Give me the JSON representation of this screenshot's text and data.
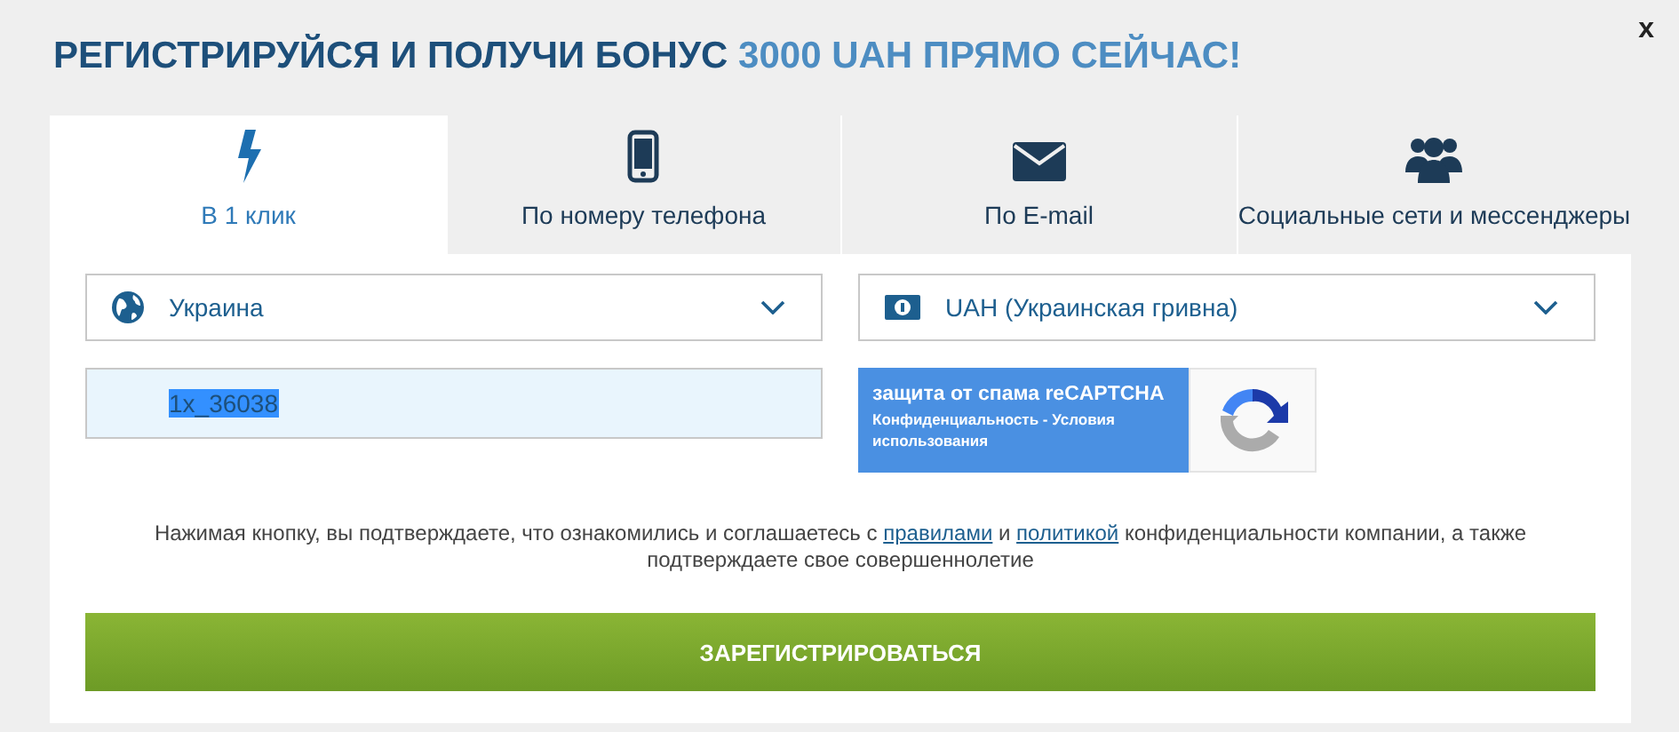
{
  "title": {
    "main": "РЕГИСТРИРУЙСЯ И ПОЛУЧИ БОНУС",
    "accent": "3000 UAH ПРЯМО СЕЙЧАС!"
  },
  "close": "x",
  "tabs": [
    {
      "label": "В 1 клик",
      "selected": true
    },
    {
      "label": "По номеру телефона",
      "selected": false
    },
    {
      "label": "По E-mail",
      "selected": false
    },
    {
      "label": "Социальные сети и мессенджеры",
      "selected": false
    }
  ],
  "country": {
    "value": "Украина"
  },
  "currency": {
    "value": "UAH (Украинская гривна)"
  },
  "username": {
    "value": "1x_36038"
  },
  "recaptcha": {
    "title": "защита от спама reCAPTCHA",
    "links": "Конфиденциальность - Условия использования"
  },
  "terms": {
    "before": "Нажимая кнопку, вы подтверждаете, что ознакомились и соглашаетесь с",
    "link_rules": "правилами",
    "middle": "и",
    "link_policy": "политикой",
    "after": "конфиденциальности компании, а также подтверждаете свое совершеннолетие"
  },
  "register_button": "ЗАРЕГИСТРИРОВАТЬСЯ"
}
